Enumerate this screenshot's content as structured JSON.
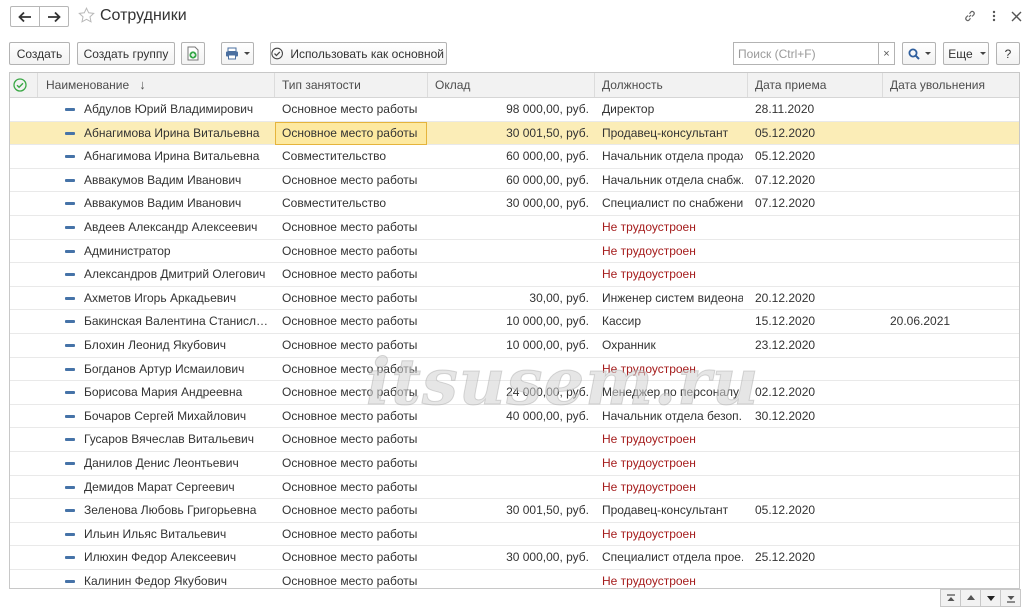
{
  "window": {
    "title": "Сотрудники"
  },
  "toolbar": {
    "create_label": "Создать",
    "create_group_label": "Создать группу",
    "set_default_label": "Использовать как основной",
    "search_placeholder": "Поиск (Ctrl+F)",
    "search_clear": "×",
    "more_label": "Еще",
    "help_label": "?"
  },
  "table": {
    "columns": [
      "Наименование",
      "Тип занятости",
      "Оклад",
      "Должность",
      "Дата приема",
      "Дата увольнения"
    ],
    "sort_indicator": "↓",
    "selected_row_index": 1,
    "rows": [
      {
        "name": "Абдулов Юрий Владимирович",
        "type": "Основное место работы",
        "salary": "98 000,00, руб.",
        "position": "Директор",
        "hired": "28.11.2020",
        "fired": ""
      },
      {
        "name": "Абнагимова Ирина Витальевна",
        "type": "Основное место работы",
        "salary": "30 001,50, руб.",
        "position": "Продавец-консультант",
        "hired": "05.12.2020",
        "fired": ""
      },
      {
        "name": "Абнагимова Ирина Витальевна",
        "type": "Совместительство",
        "salary": "60 000,00, руб.",
        "position": "Начальник отдела продаж",
        "hired": "05.12.2020",
        "fired": ""
      },
      {
        "name": "Аввакумов Вадим Иванович",
        "type": "Основное место работы",
        "salary": "60 000,00, руб.",
        "position": "Начальник отдела снабж...",
        "hired": "07.12.2020",
        "fired": ""
      },
      {
        "name": "Аввакумов Вадим Иванович",
        "type": "Совместительство",
        "salary": "30 000,00, руб.",
        "position": "Специалист по снабжени...",
        "hired": "07.12.2020",
        "fired": ""
      },
      {
        "name": "Авдеев Александр Алексеевич",
        "type": "Основное место работы",
        "salary": "",
        "position": "Не трудоустроен",
        "hired": "",
        "fired": "",
        "unemployed": true
      },
      {
        "name": "Администратор",
        "type": "Основное место работы",
        "salary": "",
        "position": "Не трудоустроен",
        "hired": "",
        "fired": "",
        "unemployed": true
      },
      {
        "name": "Александров Дмитрий Олегович",
        "type": "Основное место работы",
        "salary": "",
        "position": "Не трудоустроен",
        "hired": "",
        "fired": "",
        "unemployed": true
      },
      {
        "name": "Ахметов Игорь Аркадьевич",
        "type": "Основное место работы",
        "salary": "30,00, руб.",
        "position": "Инженер систем видеона...",
        "hired": "20.12.2020",
        "fired": ""
      },
      {
        "name": "Бакинская Валентина Станиславо...",
        "type": "Основное место работы",
        "salary": "10 000,00, руб.",
        "position": "Кассир",
        "hired": "15.12.2020",
        "fired": "20.06.2021"
      },
      {
        "name": "Блохин Леонид Якубович",
        "type": "Основное место работы",
        "salary": "10 000,00, руб.",
        "position": "Охранник",
        "hired": "23.12.2020",
        "fired": ""
      },
      {
        "name": "Богданов Артур Исмаилович",
        "type": "Основное место работы",
        "salary": "",
        "position": "Не трудоустроен",
        "hired": "",
        "fired": "",
        "unemployed": true
      },
      {
        "name": "Борисова Мария Андреевна",
        "type": "Основное место работы",
        "salary": "24 000,00, руб.",
        "position": "Менеджер по персоналу",
        "hired": "02.12.2020",
        "fired": ""
      },
      {
        "name": "Бочаров Сергей Михайлович",
        "type": "Основное место работы",
        "salary": "40 000,00, руб.",
        "position": "Начальник отдела безоп...",
        "hired": "30.12.2020",
        "fired": ""
      },
      {
        "name": "Гусаров Вячеслав Витальевич",
        "type": "Основное место работы",
        "salary": "",
        "position": "Не трудоустроен",
        "hired": "",
        "fired": "",
        "unemployed": true
      },
      {
        "name": "Данилов Денис Леонтьевич",
        "type": "Основное место работы",
        "salary": "",
        "position": "Не трудоустроен",
        "hired": "",
        "fired": "",
        "unemployed": true
      },
      {
        "name": "Демидов Марат Сергеевич",
        "type": "Основное место работы",
        "salary": "",
        "position": "Не трудоустроен",
        "hired": "",
        "fired": "",
        "unemployed": true
      },
      {
        "name": "Зеленова Любовь Григорьевна",
        "type": "Основное место работы",
        "salary": "30 001,50, руб.",
        "position": "Продавец-консультант",
        "hired": "05.12.2020",
        "fired": ""
      },
      {
        "name": "Ильин Ильяс Витальевич",
        "type": "Основное место работы",
        "salary": "",
        "position": "Не трудоустроен",
        "hired": "",
        "fired": "",
        "unemployed": true
      },
      {
        "name": "Илюхин Федор Алексеевич",
        "type": "Основное место работы",
        "salary": "30 000,00, руб.",
        "position": "Специалист отдела прое...",
        "hired": "25.12.2020",
        "fired": ""
      },
      {
        "name": "Калинин Федор Якубович",
        "type": "Основное место работы",
        "salary": "",
        "position": "Не трудоустроен",
        "hired": "",
        "fired": "",
        "unemployed": true
      }
    ]
  },
  "watermark": "itsusem.ru",
  "colors": {
    "accent_blue": "#4673a8",
    "selected_row": "#fbedb7",
    "unemployed_text": "#a51c1c",
    "check_green": "#3aa845"
  },
  "icons": {
    "back": "arrow-left-icon",
    "forward": "arrow-right-icon",
    "favorite": "star-icon",
    "link": "link-icon",
    "menu": "more-vertical-icon",
    "close": "close-icon",
    "copy_green": "add-copy-icon",
    "print": "printer-icon",
    "set_default": "check-circle-icon",
    "search": "search-icon",
    "header_check": "check-circle-icon",
    "row": "employee-row-icon"
  }
}
